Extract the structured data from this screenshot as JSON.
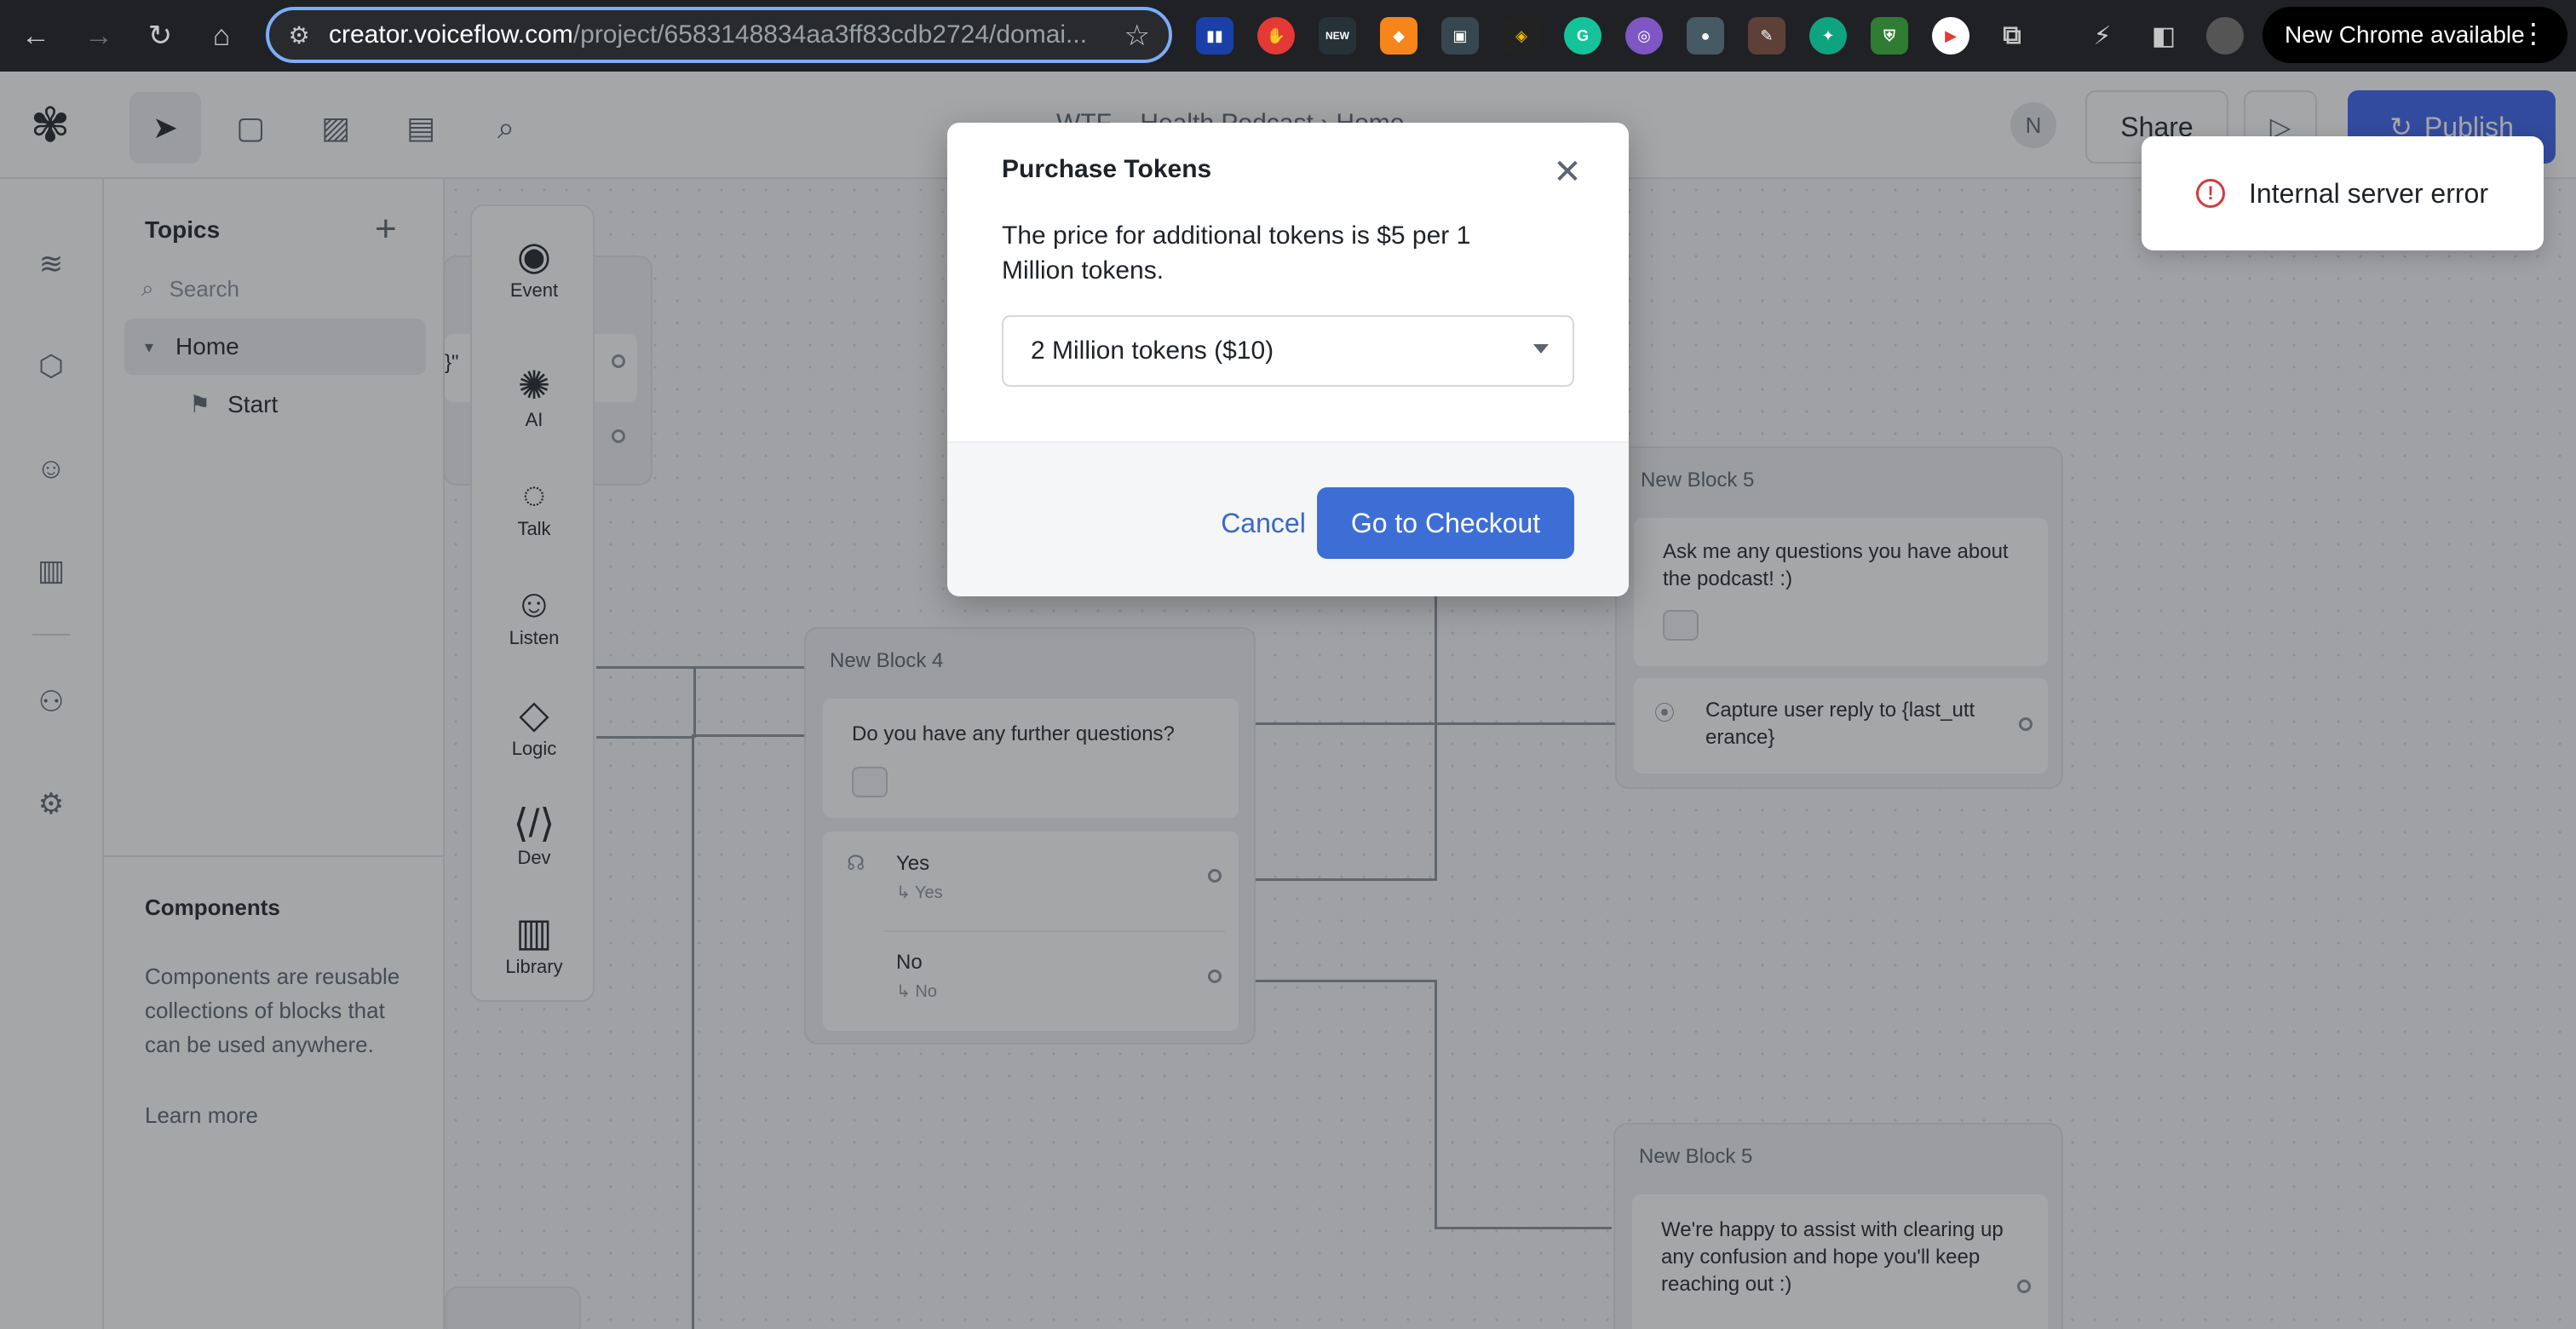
{
  "browser": {
    "url_host": "creator.voiceflow.com",
    "url_path": "/project/6583148834aa3ff83cdb2724/domai...",
    "update_label": "New Chrome available"
  },
  "toolbar": {
    "project_title": "WTF – Health Podcast › Home",
    "avatar_initial": "N",
    "share_label": "Share",
    "publish_label": "Publish"
  },
  "topics": {
    "title": "Topics",
    "search_placeholder": "Search",
    "home_label": "Home",
    "start_label": "Start",
    "components_title": "Components",
    "components_desc": "Components are reusable collections of blocks that can be used anywhere.",
    "learn_more": "Learn more"
  },
  "steps": [
    {
      "label": "Event",
      "icon": "event-icon"
    },
    {
      "label": "AI",
      "icon": "ai-icon"
    },
    {
      "label": "Talk",
      "icon": "talk-icon"
    },
    {
      "label": "Listen",
      "icon": "listen-icon"
    },
    {
      "label": "Logic",
      "icon": "logic-icon"
    },
    {
      "label": "Dev",
      "icon": "dev-icon"
    },
    {
      "label": "Library",
      "icon": "library-icon"
    }
  ],
  "canvas": {
    "block4": {
      "title": "New Block 4",
      "message": "Do you have any further questions?",
      "choice_yes": "Yes",
      "choice_yes_sub": "↳ Yes",
      "choice_no": "No",
      "choice_no_sub": "↳ No"
    },
    "block5a": {
      "title": "New Block 5",
      "message": "Ask me any questions you have about the podcast! :)",
      "capture": "Capture user reply to {last_utt erance}"
    },
    "block5b": {
      "title": "New Block 5",
      "message": "We're happy to assist with clearing up any confusion and hope you'll keep reaching out :)"
    },
    "partial_text": "}\""
  },
  "modal": {
    "title": "Purchase Tokens",
    "description": "The price for additional tokens is $5 per 1 Million tokens.",
    "selected_option": "2 Million tokens ($10)",
    "cancel_label": "Cancel",
    "checkout_label": "Go to Checkout"
  },
  "toast": {
    "message": "Internal server error"
  },
  "colors": {
    "primary": "#3c6ed5",
    "error": "#d33a3a",
    "publish": "#3b63f0"
  }
}
